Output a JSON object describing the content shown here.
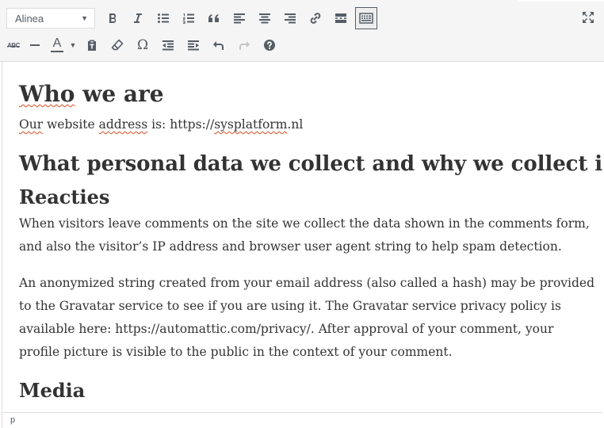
{
  "toolbar": {
    "format_select": {
      "value": "Alinea"
    },
    "row1_buttons": [
      "bold-icon",
      "italic-icon",
      "bullet-list-icon",
      "numbered-list-icon",
      "blockquote-icon",
      "align-left-icon",
      "align-center-icon",
      "align-right-icon",
      "link-icon",
      "read-more-icon",
      "toolbar-toggle-icon"
    ],
    "row2_buttons": [
      "strikethrough-icon",
      "horizontal-line-icon",
      "text-color-icon",
      "paste-as-text-icon",
      "clear-formatting-icon",
      "special-character-icon",
      "outdent-icon",
      "indent-icon",
      "undo-icon",
      "redo-icon",
      "help-icon"
    ],
    "strikethrough_label": "ABC",
    "text_color_label": "A",
    "text_color": "#555d66",
    "omega_label": "Ω",
    "toggle_active": true,
    "redo_enabled": false
  },
  "content": {
    "h_who": "Who we are",
    "h_who_words": [
      "Who",
      "we are"
    ],
    "p1_parts": [
      "Our",
      " website ",
      "address",
      " is: https://",
      "sysplatform",
      ".nl"
    ],
    "h_what": "What personal data we collect and why we collect it",
    "h_reacties": "Reacties",
    "p2": "When visitors leave comments on the site we collect the data shown in the comments form, and also the visitor’s IP address and browser user agent string to help spam detection.",
    "p3": "An anonymized string created from your email address (also called a hash) may be provided to the Gravatar service to see if you are using it. The Gravatar service privacy policy is available here: https://automattic.com/privacy/. After approval of your comment, your profile picture is visible to the public in the context of your comment.",
    "h_media": "Media"
  },
  "statusbar": {
    "path": "p"
  },
  "colors": {
    "icon": "#555d66",
    "spell_underline": "#d54e21",
    "text": "#333333",
    "toolbar_bg": "#f5f5f5"
  }
}
